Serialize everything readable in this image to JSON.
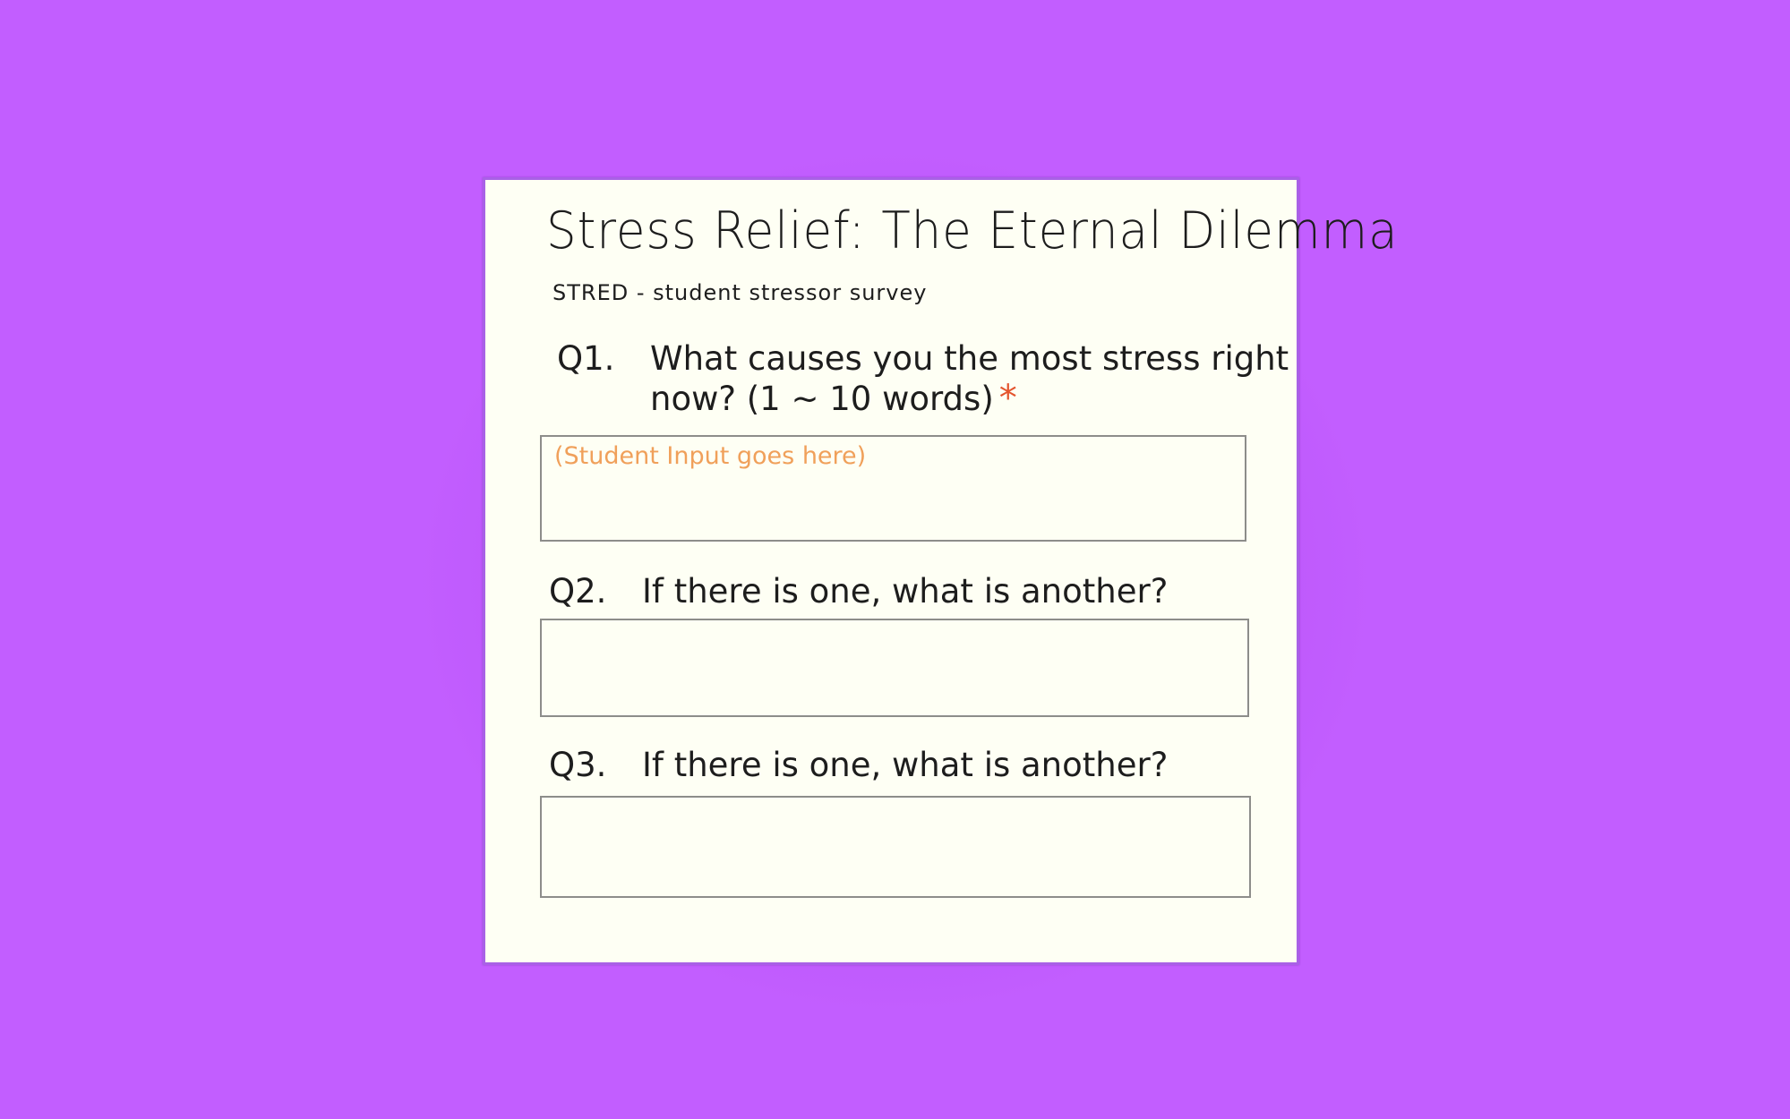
{
  "colors": {
    "background": "#c25eff",
    "card": "#fefff4",
    "ink": "#1d1d1d",
    "required": "#e4542d",
    "placeholder": "#f0a05a"
  },
  "form": {
    "title": "Stress Relief: The Eternal Dilemma",
    "subtitle": "STRED - student stressor survey",
    "questions": [
      {
        "number": "Q1.",
        "text_line1": "What causes you the most stress right",
        "text_line2": "now? (1 ~ 10 words)",
        "required_mark": "*",
        "placeholder": "(Student Input goes here)",
        "value": ""
      },
      {
        "number": "Q2.",
        "text": "If there is one, what is another?",
        "value": ""
      },
      {
        "number": "Q3.",
        "text": "If there is one, what is another?",
        "value": ""
      }
    ]
  }
}
